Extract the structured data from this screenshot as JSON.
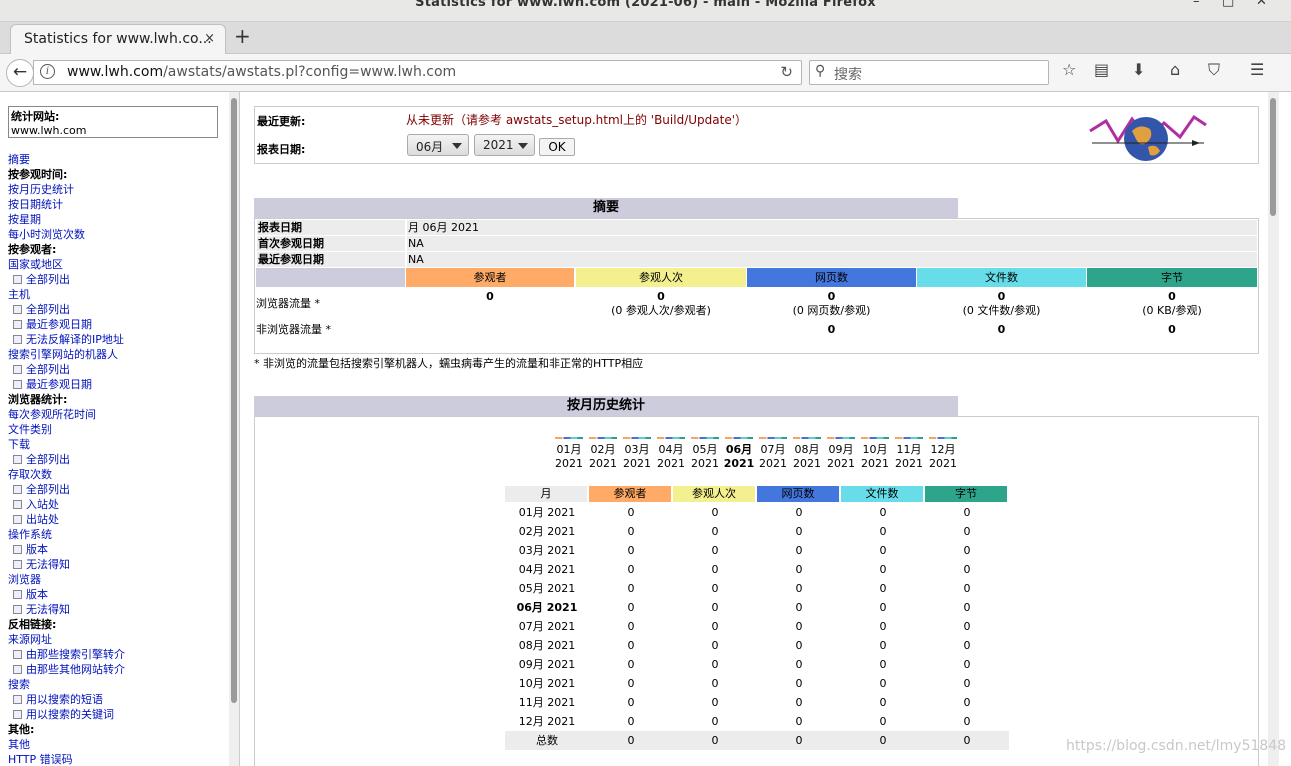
{
  "window": {
    "title": "Statistics for www.lwh.com (2021-06) - main - Mozilla Firefox"
  },
  "tab": {
    "label": "Statistics for www.lwh.co...",
    "close": "×",
    "new": "+"
  },
  "nav": {
    "url_host": "www.lwh.com",
    "url_path": "/awstats/awstats.pl?config=www.lwh.com",
    "search_placeholder": "搜索"
  },
  "sidebar": {
    "site_label": "统计网站:",
    "site_value": "www.lwh.com",
    "items": [
      {
        "type": "link",
        "label": "摘要"
      },
      {
        "type": "head",
        "label": "按参观时间:"
      },
      {
        "type": "link",
        "label": "按月历史统计"
      },
      {
        "type": "link",
        "label": "按日期统计"
      },
      {
        "type": "link",
        "label": "按星期"
      },
      {
        "type": "link",
        "label": "每小时浏览次数"
      },
      {
        "type": "head",
        "label": "按参观者:"
      },
      {
        "type": "link",
        "label": "国家或地区"
      },
      {
        "type": "sub",
        "label": "全部列出"
      },
      {
        "type": "link",
        "label": "主机"
      },
      {
        "type": "sub",
        "label": "全部列出"
      },
      {
        "type": "sub",
        "label": "最近参观日期"
      },
      {
        "type": "sub",
        "label": "无法反解译的IP地址"
      },
      {
        "type": "link",
        "label": "搜索引擎网站的机器人"
      },
      {
        "type": "sub",
        "label": "全部列出"
      },
      {
        "type": "sub",
        "label": "最近参观日期"
      },
      {
        "type": "head",
        "label": "浏览器统计:"
      },
      {
        "type": "link",
        "label": "每次参观所花时间"
      },
      {
        "type": "link",
        "label": "文件类别"
      },
      {
        "type": "link",
        "label": "下载"
      },
      {
        "type": "sub",
        "label": "全部列出"
      },
      {
        "type": "link",
        "label": "存取次数"
      },
      {
        "type": "sub",
        "label": "全部列出"
      },
      {
        "type": "sub",
        "label": "入站处"
      },
      {
        "type": "sub",
        "label": "出站处"
      },
      {
        "type": "link",
        "label": "操作系统"
      },
      {
        "type": "sub",
        "label": "版本"
      },
      {
        "type": "sub",
        "label": "无法得知"
      },
      {
        "type": "link",
        "label": "浏览器"
      },
      {
        "type": "sub",
        "label": "版本"
      },
      {
        "type": "sub",
        "label": "无法得知"
      },
      {
        "type": "head",
        "label": "反相链接:"
      },
      {
        "type": "link",
        "label": "来源网址"
      },
      {
        "type": "sub",
        "label": "由那些搜索引擎转介"
      },
      {
        "type": "sub",
        "label": "由那些其他网站转介"
      },
      {
        "type": "link",
        "label": "搜索"
      },
      {
        "type": "sub",
        "label": "用以搜索的短语"
      },
      {
        "type": "sub",
        "label": "用以搜索的关键词"
      },
      {
        "type": "head",
        "label": "其他:"
      },
      {
        "type": "link",
        "label": "其他"
      },
      {
        "type": "link",
        "label": "HTTP 错误码"
      }
    ]
  },
  "top": {
    "last_update_label": "最近更新:",
    "last_update_value": "从未更新（请参考 awstats_setup.html上的 'Build/Update'）",
    "report_date_label": "报表日期:",
    "month_select": "06月",
    "year_select": "2021",
    "ok": "OK"
  },
  "summary": {
    "title": "摘要",
    "rows": [
      {
        "label": "报表日期",
        "value": "月 06月 2021"
      },
      {
        "label": "首次参观日期",
        "value": "NA"
      },
      {
        "label": "最近参观日期",
        "value": "NA"
      }
    ],
    "headers": [
      "参观者",
      "参观人次",
      "网页数",
      "文件数",
      "字节"
    ],
    "header_colors": [
      "#ffaa66",
      "#f4f090",
      "#4477dd",
      "#66dde8",
      "#2ea58a"
    ],
    "browser_label": "浏览器流量 *",
    "browser_values": [
      "0",
      "0",
      "0",
      "0",
      "0"
    ],
    "browser_sub": [
      "",
      "(0 参观人次/参观者)",
      "(0 网页数/参观)",
      "(0 文件数/参观)",
      "(0 KB/参观)"
    ],
    "nonbrowser_label": "非浏览器流量 *",
    "nonbrowser_values": [
      "0",
      "0",
      "0"
    ],
    "note": "* 非浏览的流量包括搜索引擎机器人，蠕虫病毒产生的流量和非正常的HTTP相应"
  },
  "history": {
    "title": "按月历史统计",
    "months": [
      "01月",
      "02月",
      "03月",
      "04月",
      "05月",
      "06月",
      "07月",
      "08月",
      "09月",
      "10月",
      "11月",
      "12月"
    ],
    "year": "2021",
    "current_index": 5,
    "table_headers": [
      "月",
      "参观者",
      "参观人次",
      "网页数",
      "文件数",
      "字节"
    ],
    "rows": [
      [
        "01月 2021",
        "0",
        "0",
        "0",
        "0",
        "0"
      ],
      [
        "02月 2021",
        "0",
        "0",
        "0",
        "0",
        "0"
      ],
      [
        "03月 2021",
        "0",
        "0",
        "0",
        "0",
        "0"
      ],
      [
        "04月 2021",
        "0",
        "0",
        "0",
        "0",
        "0"
      ],
      [
        "05月 2021",
        "0",
        "0",
        "0",
        "0",
        "0"
      ],
      [
        "06月 2021",
        "0",
        "0",
        "0",
        "0",
        "0"
      ],
      [
        "07月 2021",
        "0",
        "0",
        "0",
        "0",
        "0"
      ],
      [
        "08月 2021",
        "0",
        "0",
        "0",
        "0",
        "0"
      ],
      [
        "09月 2021",
        "0",
        "0",
        "0",
        "0",
        "0"
      ],
      [
        "10月 2021",
        "0",
        "0",
        "0",
        "0",
        "0"
      ],
      [
        "11月 2021",
        "0",
        "0",
        "0",
        "0",
        "0"
      ],
      [
        "12月 2021",
        "0",
        "0",
        "0",
        "0",
        "0"
      ],
      [
        "总数",
        "0",
        "0",
        "0",
        "0",
        "0"
      ]
    ]
  },
  "watermark": "https://blog.csdn.net/lmy51848"
}
